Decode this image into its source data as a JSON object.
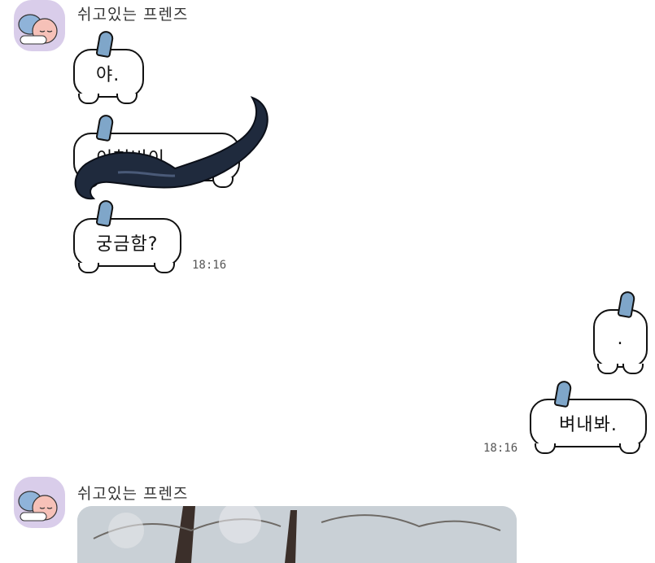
{
  "sender": "쉬고있는 프렌즈",
  "messages": [
    {
      "text": "야.",
      "side": "left"
    },
    {
      "text": "이현빈이",
      "side": "left"
    },
    {
      "text": "궁금함?",
      "side": "left",
      "time": "18:16"
    },
    {
      "text": ".",
      "side": "right"
    },
    {
      "text": "벼내봐.",
      "side": "right",
      "time": "18:16"
    }
  ],
  "colors": {
    "avatar_bg": "#d9cdea",
    "stem": "#7fa6c9",
    "mustache": "#1f2a3d"
  }
}
